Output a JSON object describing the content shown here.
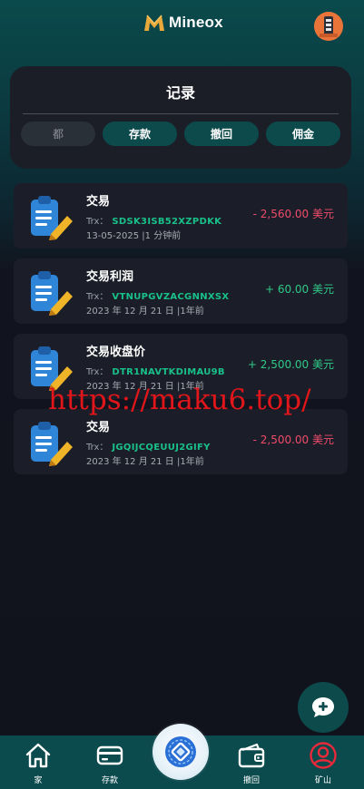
{
  "header": {
    "app_name": "Mineox",
    "logo_icon": "mineox-logo-icon",
    "avatar_icon": "profile-avatar-icon"
  },
  "records": {
    "title": "记录",
    "tabs": [
      {
        "label": "都",
        "active": true
      },
      {
        "label": "存款",
        "active": false
      },
      {
        "label": "撤回",
        "active": false
      },
      {
        "label": "佣金",
        "active": false
      }
    ]
  },
  "transactions": [
    {
      "title": "交易",
      "trx_label": "Trx：",
      "trx_code": "SDSK3ISB52XZPDKK",
      "date": "13-05-2025 |1 分钟前",
      "amount": "- 2,560.00 美元",
      "direction": "neg"
    },
    {
      "title": "交易利润",
      "trx_label": "Trx：",
      "trx_code": "VTNUPGVZACGNNXSX",
      "date": "2023 年 12 月 21 日 |1年前",
      "amount": "+ 60.00 美元",
      "direction": "pos"
    },
    {
      "title": "交易收盘价",
      "trx_label": "Trx：",
      "trx_code": "DTR1NAVTKDIMAU9B",
      "date": "2023 年 12 月 21 日 |1年前",
      "amount": "+ 2,500.00 美元",
      "direction": "pos"
    },
    {
      "title": "交易",
      "trx_label": "Trx：",
      "trx_code": "JGQIJCQEUUJ2GIFY",
      "date": "2023 年 12 月 21 日 |1年前",
      "amount": "- 2,500.00 美元",
      "direction": "neg"
    }
  ],
  "watermark": "https://maku6.top/",
  "nav": [
    {
      "label": "家",
      "icon": "home-icon"
    },
    {
      "label": "存款",
      "icon": "card-icon"
    },
    {
      "label": "",
      "icon": "mining-center-icon"
    },
    {
      "label": "撤回",
      "icon": "wallet-icon"
    },
    {
      "label": "矿山",
      "icon": "user-circle-icon"
    }
  ],
  "colors": {
    "accent": "#0d4a4c",
    "negative": "#ef4b6a",
    "positive": "#2fc989",
    "code": "#19c08a"
  }
}
